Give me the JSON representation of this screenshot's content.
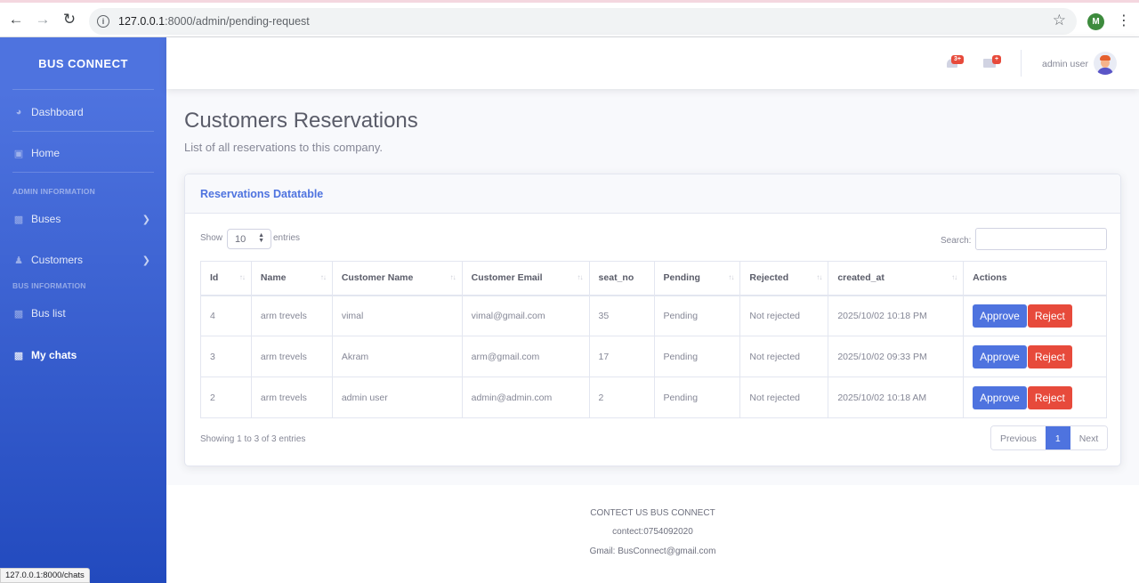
{
  "browser": {
    "url_host": "127.0.0.1",
    "url_rest": ":8000/admin/pending-request",
    "profile_initial": "M",
    "status_url": "127.0.0.1:8000/chats"
  },
  "sidebar": {
    "brand": "BUS CONNECT",
    "items": [
      {
        "label": "Dashboard",
        "icon": "dashboard-icon"
      },
      {
        "label": "Home",
        "icon": "home-icon"
      },
      {
        "label": "Buses",
        "icon": "bus-icon"
      },
      {
        "label": "Customers",
        "icon": "users-icon"
      },
      {
        "label": "Bus list",
        "icon": "bus-icon"
      },
      {
        "label": "My chats",
        "icon": "bus-icon"
      }
    ],
    "headings": [
      "ADMIN INFORMATION",
      "BUS INFORMATION"
    ]
  },
  "topbar": {
    "alerts_badge": "3+",
    "messages_badge": "+",
    "user_name": "admin user"
  },
  "page": {
    "title": "Customers Reservations",
    "subtitle": "List of all reservations to this company."
  },
  "card": {
    "title": "Reservations Datatable",
    "show_label": "Show",
    "entries_value": "10",
    "entries_label": "entries",
    "search_label": "Search:",
    "columns": [
      "Id",
      "Name",
      "Customer Name",
      "Customer Email",
      "seat_no",
      "Pending",
      "Rejected",
      "created_at",
      "Actions"
    ],
    "rows": [
      {
        "id": "4",
        "name": "arm trevels",
        "customer_name": "vimal",
        "email": "vimal@gmail.com",
        "seat_no": "35",
        "pending": "Pending",
        "rejected": "Not rejected",
        "created_at": "2025/10/02 10:18 PM"
      },
      {
        "id": "3",
        "name": "arm trevels",
        "customer_name": "Akram",
        "email": "arm@gmail.com",
        "seat_no": "17",
        "pending": "Pending",
        "rejected": "Not rejected",
        "created_at": "2025/10/02 09:33 PM"
      },
      {
        "id": "2",
        "name": "arm trevels",
        "customer_name": "admin user",
        "email": "admin@admin.com",
        "seat_no": "2",
        "pending": "Pending",
        "rejected": "Not rejected",
        "created_at": "2025/10/02 10:18 AM"
      }
    ],
    "approve_label": "Approve",
    "reject_label": "Reject",
    "info": "Showing 1 to 3 of 3 entries",
    "pager": {
      "previous": "Previous",
      "current": "1",
      "next": "Next"
    }
  },
  "footer": {
    "line1": "CONTECT US BUS CONNECT",
    "line2": "contect:0754092020",
    "line3": "Gmail: BusConnect@gmail.com"
  },
  "colors": {
    "primary": "#4e73df",
    "danger": "#e74a3b",
    "warning": "#f6c23e",
    "info": "#36b9cc"
  }
}
